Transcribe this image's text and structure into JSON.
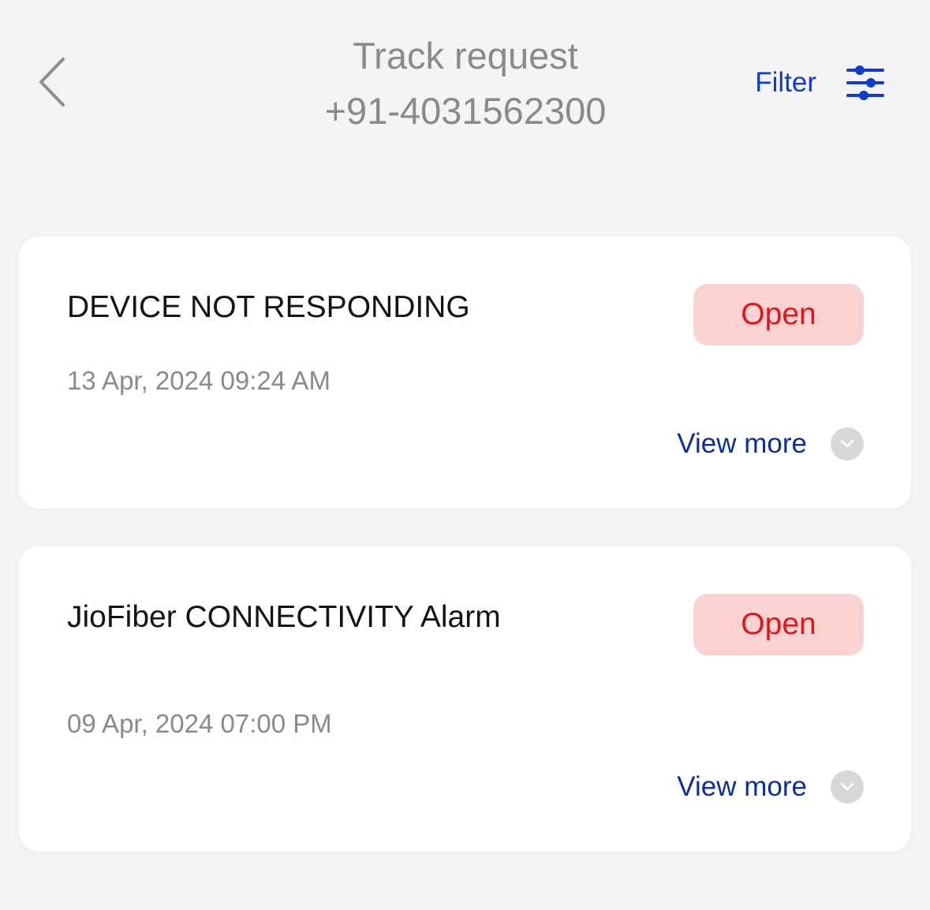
{
  "header": {
    "title": "Track request",
    "subtitle": "+91-4031562300",
    "filter_label": "Filter"
  },
  "requests": [
    {
      "title": "DEVICE NOT RESPONDING",
      "date": "13 Apr, 2024 09:24 AM",
      "status": "Open",
      "view_more_label": "View more"
    },
    {
      "title": "JioFiber CONNECTIVITY Alarm",
      "date": "09 Apr, 2024 07:00 PM",
      "status": "Open",
      "view_more_label": "View more"
    }
  ],
  "colors": {
    "background": "#f4f4f6",
    "accent_blue": "#0f3cc9",
    "status_open_bg": "#fbd2d2",
    "status_open_text": "#e0161e",
    "muted_text": "#8a8a8a"
  },
  "icons": {
    "back": "chevron-left-icon",
    "filter": "sliders-icon",
    "expand": "chevron-down-icon"
  }
}
